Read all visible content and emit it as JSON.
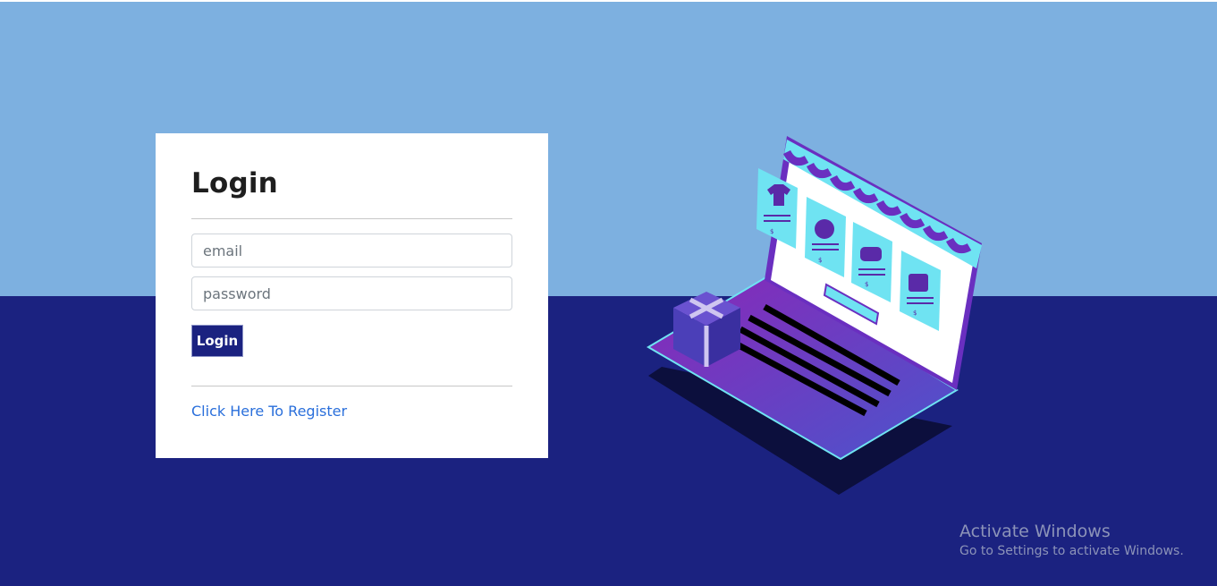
{
  "login": {
    "title": "Login",
    "email_placeholder": "email",
    "password_placeholder": "password",
    "submit_label": "Login",
    "register_link": "Click Here To Register"
  },
  "illustration": {
    "price_symbol": "$"
  },
  "watermark": {
    "title": "Activate Windows",
    "subtitle": "Go to Settings to activate Windows."
  },
  "colors": {
    "bg_top": "#7db0e0",
    "bg_bottom": "#1b2280",
    "accent": "#1b2280",
    "link": "#2a6fdb"
  }
}
